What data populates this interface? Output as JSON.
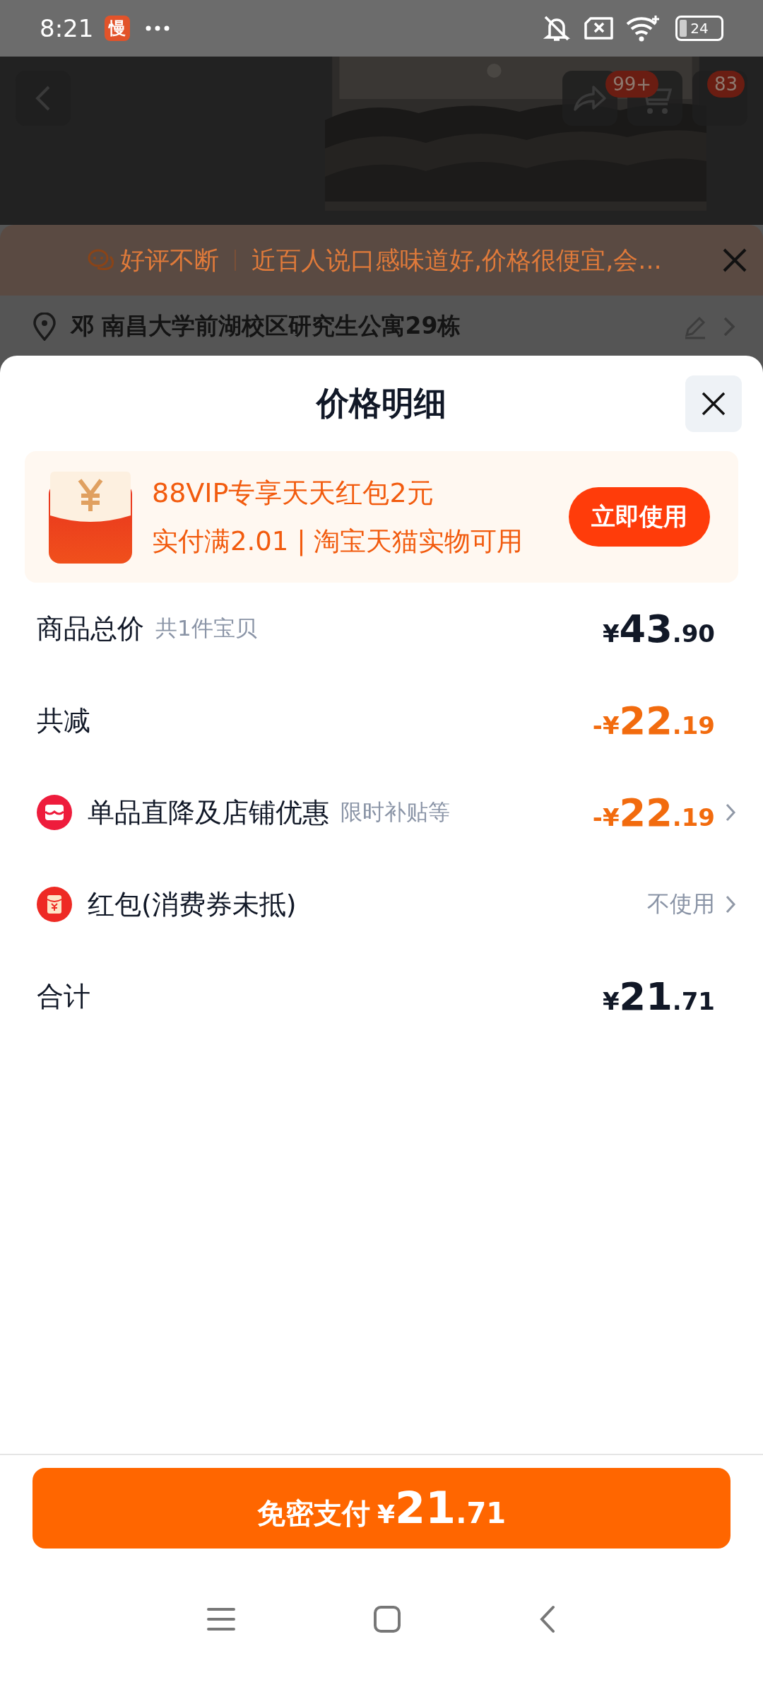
{
  "status_bar": {
    "time": "8:21",
    "app_badge": "慢",
    "battery": "24"
  },
  "header": {
    "cart_badge": "99+",
    "message_badge": "83"
  },
  "review_banner": {
    "tag": "好评不断",
    "text": "近百人说口感味道好,价格很便宜,会..."
  },
  "address": {
    "text": "邓 南昌大学前湖校区研究生公寓29栋"
  },
  "sheet": {
    "title": "价格明细"
  },
  "coupon": {
    "title": "88VIP专享天天红包2元",
    "condition": "实付满2.01 | 淘宝天猫实物可用",
    "button": "立即使用"
  },
  "rows": [
    {
      "kind": "plain",
      "label": "商品总价",
      "note": "共1件宝贝",
      "color": "#111827",
      "price": {
        "prefix": "¥",
        "main": "43",
        "decimal": ".90"
      },
      "chevron": false
    },
    {
      "kind": "plain",
      "label": "共减",
      "color": "#f26b0e",
      "price": {
        "prefix": "-¥",
        "main": "22",
        "decimal": ".19"
      },
      "chevron": false
    },
    {
      "kind": "shop",
      "label": "单品直降及店铺优惠",
      "note": "限时补贴等",
      "color": "#f26b0e",
      "price": {
        "prefix": "-¥",
        "main": "22",
        "decimal": ".19"
      },
      "chevron": true
    },
    {
      "kind": "envelope",
      "label": "红包(消费券未抵)",
      "value": "不使用",
      "chevron": true
    },
    {
      "kind": "plain",
      "label": "合计",
      "color": "#111827",
      "price": {
        "prefix": "¥",
        "main": "21",
        "decimal": ".71"
      },
      "chevron": false
    }
  ],
  "pay_button": {
    "label": "免密支付",
    "price": {
      "prefix": "¥",
      "main": "21",
      "decimal": ".71"
    }
  }
}
